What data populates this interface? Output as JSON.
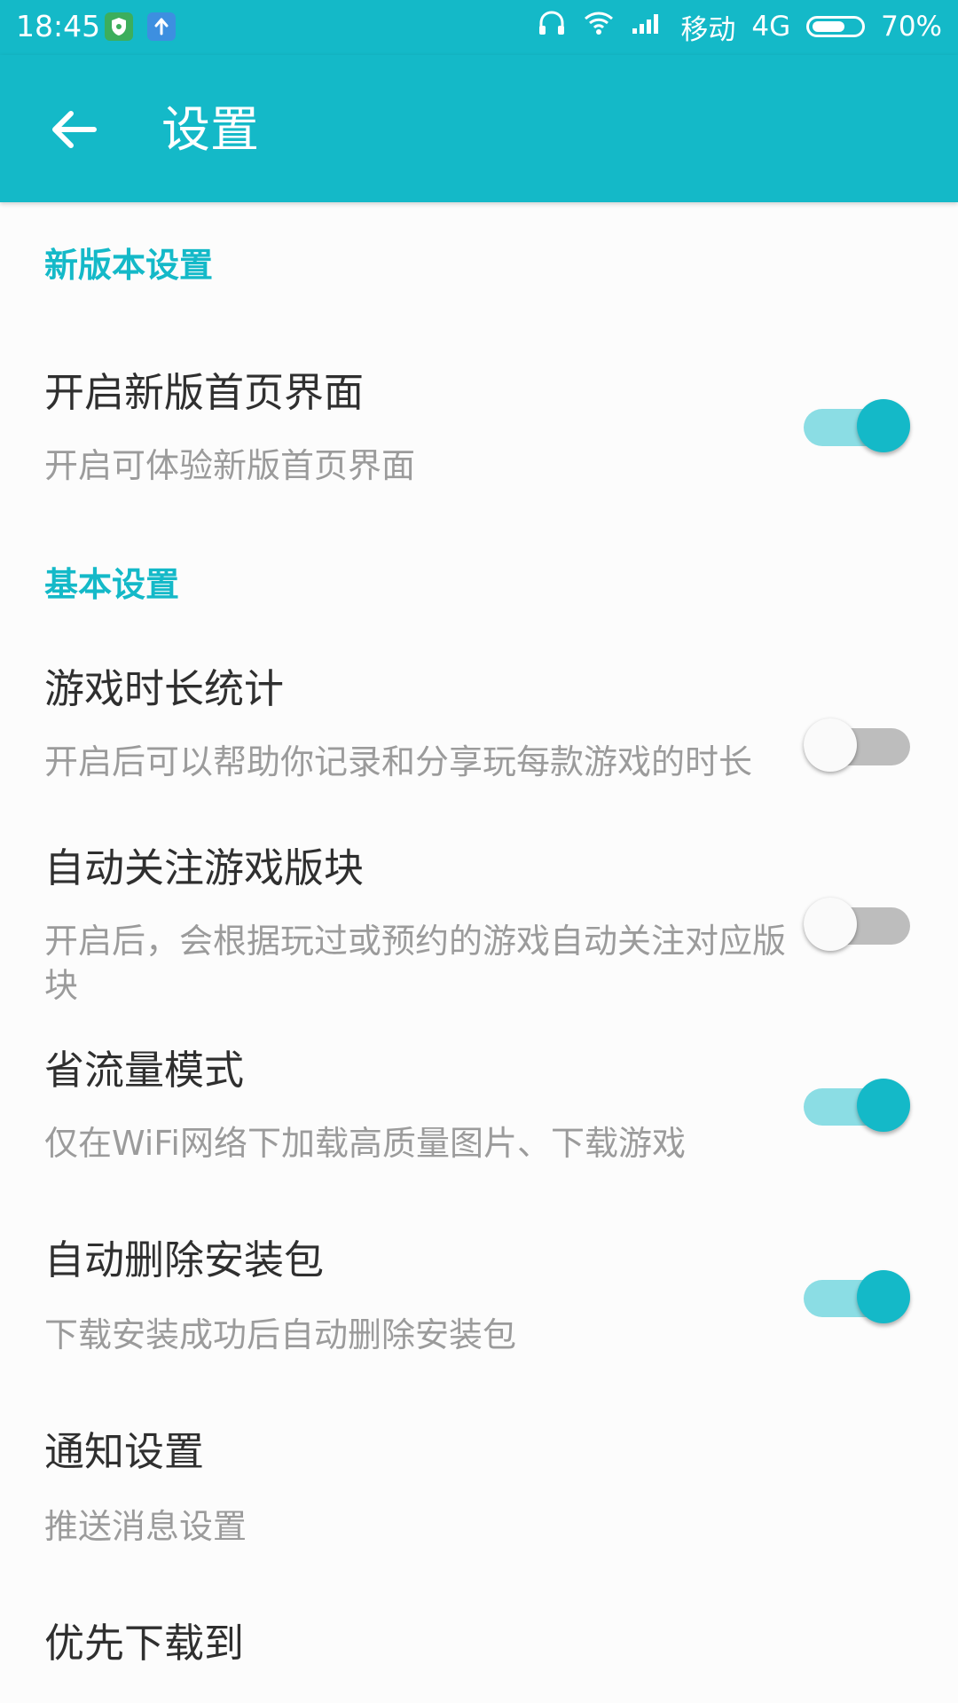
{
  "status_bar": {
    "time": "18:45",
    "carrier": "移动",
    "network": "4G",
    "battery_percent": "70%",
    "battery_level": 0.7,
    "icons": [
      "shield-notification-icon",
      "upload-notification-icon",
      "headphones-icon",
      "wifi-icon",
      "signal-icon",
      "battery-icon"
    ],
    "colors": {
      "shield_icon_bg": "#3cae5c",
      "upload_icon_bg": "#3d8fe0"
    }
  },
  "app_bar": {
    "title": "设置",
    "back_icon": "arrow-back-icon",
    "background": "#14b9c8"
  },
  "sections": [
    {
      "header": "新版本设置",
      "items": [
        {
          "title": "开启新版首页界面",
          "description": "开启可体验新版首页界面",
          "toggle_on": true
        }
      ]
    },
    {
      "header": "基本设置",
      "items": [
        {
          "title": "游戏时长统计",
          "description": "开启后可以帮助你记录和分享玩每款游戏的时长",
          "toggle_on": false
        },
        {
          "title": "自动关注游戏版块",
          "description": "开启后，会根据玩过或预约的游戏自动关注对应版块",
          "toggle_on": false
        },
        {
          "title": "省流量模式",
          "description": "仅在WiFi网络下加载高质量图片、下载游戏",
          "toggle_on": true
        },
        {
          "title": "自动删除安装包",
          "description": "下载安装成功后自动删除安装包",
          "toggle_on": true
        },
        {
          "title": "通知设置",
          "description": "推送消息设置"
        },
        {
          "title": "优先下载到",
          "description": ""
        }
      ]
    }
  ],
  "colors": {
    "accent": "#14b9c8",
    "toggle_track_on": "#8bdde4",
    "toggle_track_off": "#bdbdbd",
    "title_text": "#2f2f2f",
    "desc_text": "#9b9b9b"
  }
}
